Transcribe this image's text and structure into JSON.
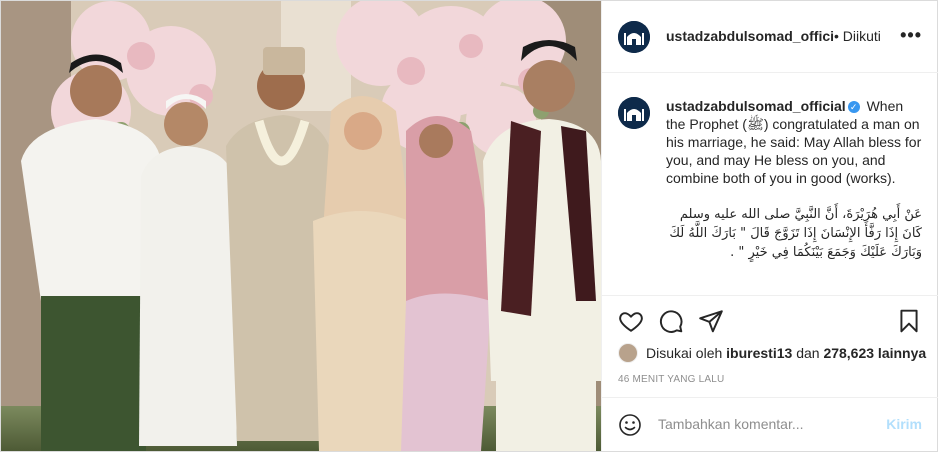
{
  "post": {
    "username": "ustadzabdulsomad_official",
    "separator": "•",
    "follow_status": "Diikuti",
    "more_icon": "more-horizontal-icon",
    "photo_description_icon": "wedding-photo"
  },
  "caption": {
    "username": "ustadzabdulsomad_official",
    "verified_icon": "verified-badge-icon",
    "english": "When the Prophet (ﷺ) congratulated a man on his marriage, he said: May Allah bless for you, and may He bless on you, and combine both of you in good (works).",
    "arabic": "عَنْ أَبِي هُرَيْرَةَ، أَنَّ النَّبِيَّ صلى الله عليه وسلم كَانَ إِذَا رَفَّأَ الإِنْسَانَ إِذَا تَزَوَّجَ قَالَ \" بَارَكَ اللَّهُ لَكَ وَبَارَكَ عَلَيْكَ وَجَمَعَ بَيْنَكُمَا فِي خَيْرٍ \" ."
  },
  "actions": {
    "like_icon": "heart-icon",
    "comment_icon": "comment-icon",
    "share_icon": "send-icon",
    "save_icon": "bookmark-icon"
  },
  "likes": {
    "prefix": "Disukai oleh",
    "user": "iburesti13",
    "joiner": "dan",
    "count": "278,623 lainnya"
  },
  "timestamp": "46 MENIT YANG LALU",
  "comment_box": {
    "emoji_icon": "smiley-icon",
    "placeholder": "Tambahkan komentar...",
    "post_label": "Kirim"
  },
  "colors": {
    "verified": "#3897f0",
    "post_button_disabled": "#b2dffc",
    "muted_text": "#8e8e8e",
    "border": "#efefef"
  }
}
